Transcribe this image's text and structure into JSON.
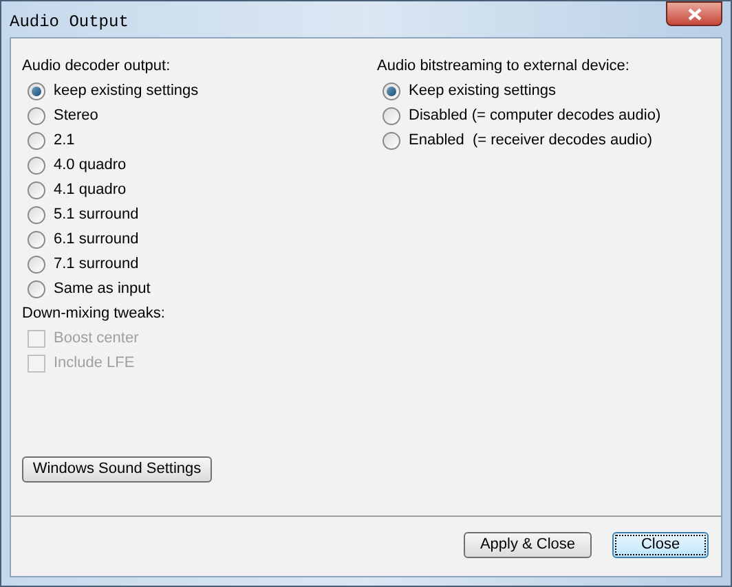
{
  "window": {
    "title": "Audio Output"
  },
  "decoder_output": {
    "label": "Audio decoder output:",
    "options": [
      {
        "label": "keep existing settings",
        "selected": true
      },
      {
        "label": "Stereo",
        "selected": false
      },
      {
        "label": "2.1",
        "selected": false
      },
      {
        "label": "4.0 quadro",
        "selected": false
      },
      {
        "label": "4.1 quadro",
        "selected": false
      },
      {
        "label": "5.1 surround",
        "selected": false
      },
      {
        "label": "6.1 surround",
        "selected": false
      },
      {
        "label": "7.1 surround",
        "selected": false
      },
      {
        "label": "Same as input",
        "selected": false
      }
    ]
  },
  "downmixing": {
    "label": "Down-mixing tweaks:",
    "options": [
      {
        "label": "Boost center",
        "checked": false,
        "disabled": true
      },
      {
        "label": "Include LFE",
        "checked": false,
        "disabled": true
      }
    ]
  },
  "bitstreaming": {
    "label": "Audio bitstreaming to external device:",
    "options": [
      {
        "label": "Keep existing settings",
        "selected": true
      },
      {
        "label": "Disabled (= computer decodes audio)",
        "selected": false
      },
      {
        "label": "Enabled  (= receiver decodes audio)",
        "selected": false
      }
    ]
  },
  "sound_settings_button": "Windows Sound Settings",
  "buttons": [
    {
      "label": "Apply & Close",
      "focused": false
    },
    {
      "label": "Close",
      "focused": true
    }
  ]
}
